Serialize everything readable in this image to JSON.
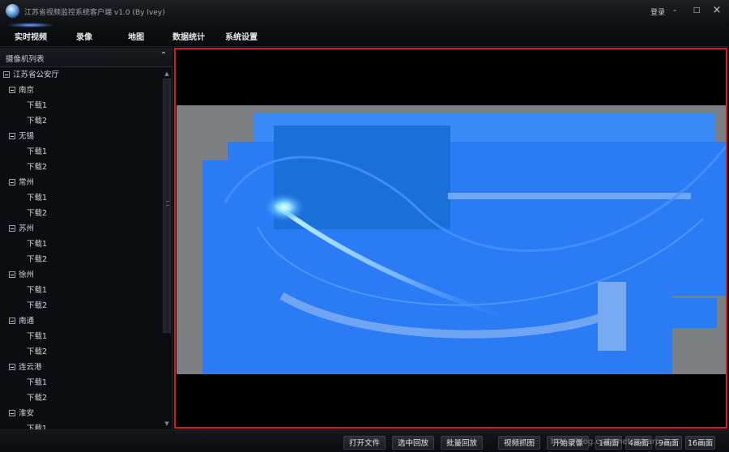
{
  "window": {
    "title": "江苏省视频监控系统客户端 v1.0 (By Ivey)",
    "login": "登录",
    "minimize": "-",
    "maximize": "□",
    "close": "×"
  },
  "menu": {
    "items": [
      {
        "label": "实时视频",
        "active": true
      },
      {
        "label": "录像"
      },
      {
        "label": "地图"
      },
      {
        "label": "数据统计"
      },
      {
        "label": "系统设置"
      }
    ]
  },
  "sidebar": {
    "title": "摄像机列表",
    "collapse_icon": "chevron-up-icon",
    "tree": {
      "root": "江苏省公安厅",
      "cities": [
        {
          "name": "南京",
          "children": [
            "下载1",
            "下载2"
          ]
        },
        {
          "name": "无锡",
          "children": [
            "下载1",
            "下载2"
          ]
        },
        {
          "name": "常州",
          "children": [
            "下载1",
            "下载2"
          ]
        },
        {
          "name": "苏州",
          "children": [
            "下载1",
            "下载2"
          ]
        },
        {
          "name": "徐州",
          "children": [
            "下载1",
            "下载2"
          ]
        },
        {
          "name": "南通",
          "children": [
            "下载1",
            "下载2"
          ]
        },
        {
          "name": "连云港",
          "children": [
            "下载1",
            "下载2"
          ]
        },
        {
          "name": "淮安",
          "children": [
            "下载1"
          ]
        }
      ]
    }
  },
  "toolbar": {
    "buttons": [
      "打开文件",
      "选中回放",
      "批量回放",
      "视频抓图",
      "开始录像",
      "1画面",
      "4画面",
      "9画面",
      "16画面"
    ]
  },
  "watermark": "http://blog.csdn.net/csharp",
  "colors": {
    "accent": "#d31c1c",
    "video_blue": "#2b7cf4"
  }
}
